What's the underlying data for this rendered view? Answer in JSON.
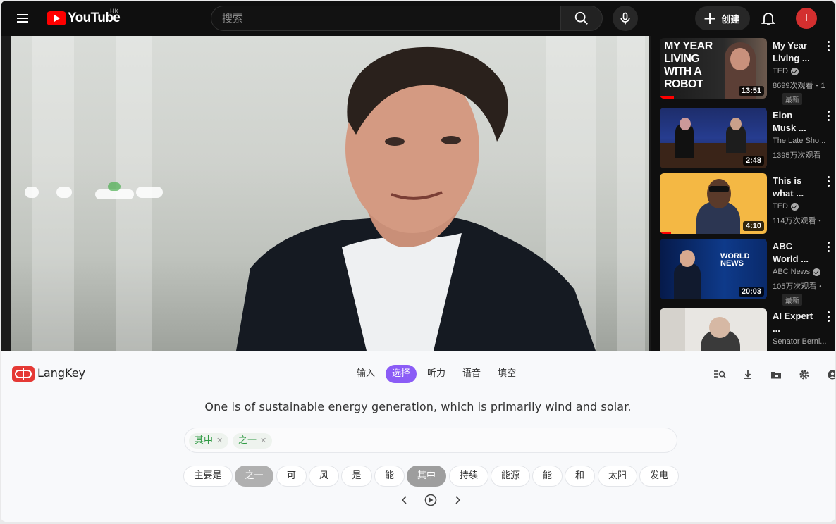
{
  "header": {
    "logo_text": "YouTube",
    "region": "HK",
    "search_placeholder": "搜索",
    "create_label": "创建",
    "avatar_initial": "I"
  },
  "video": {
    "description_hidden": ""
  },
  "recommendations": [
    {
      "title": "My Year Living ...",
      "channel": "TED",
      "verified": true,
      "stats": "8699次观看・1",
      "duration": "13:51",
      "badge": "最新",
      "thumb_text": "MY YEAR LIVING WITH A ROBOT"
    },
    {
      "title": "Elon Musk ...",
      "channel": "The Late Sho...",
      "verified": false,
      "stats": "1395万次观看",
      "duration": "2:48",
      "badge": ""
    },
    {
      "title": "This is what ...",
      "channel": "TED",
      "verified": true,
      "stats": "114万次观看・",
      "duration": "4:10",
      "badge": ""
    },
    {
      "title": "ABC World ...",
      "channel": "ABC News",
      "verified": true,
      "stats": "105万次观看・",
      "duration": "20:03",
      "badge": "最新"
    },
    {
      "title": "AI Expert ...",
      "channel": "Senator Berni...",
      "verified": false,
      "stats": "",
      "duration": "",
      "badge": ""
    }
  ],
  "langkey": {
    "name": "LangKey",
    "tabs": [
      "输入",
      "选择",
      "听力",
      "语音",
      "填空"
    ],
    "active_tab": "选择",
    "sentence": "One is of sustainable energy generation, which is primarily wind and solar.",
    "selected": [
      "其中",
      "之一"
    ],
    "options": [
      "主要是",
      "之一",
      "可",
      "风",
      "是",
      "能",
      "其中",
      "持续",
      "能源",
      "能",
      "和",
      "太阳",
      "发电"
    ],
    "used_options": [
      "之一",
      "其中"
    ]
  },
  "colors": {
    "accent": "#8b5cf6",
    "youtube_red": "#ff0000",
    "chip_green": "#2e9a43"
  }
}
